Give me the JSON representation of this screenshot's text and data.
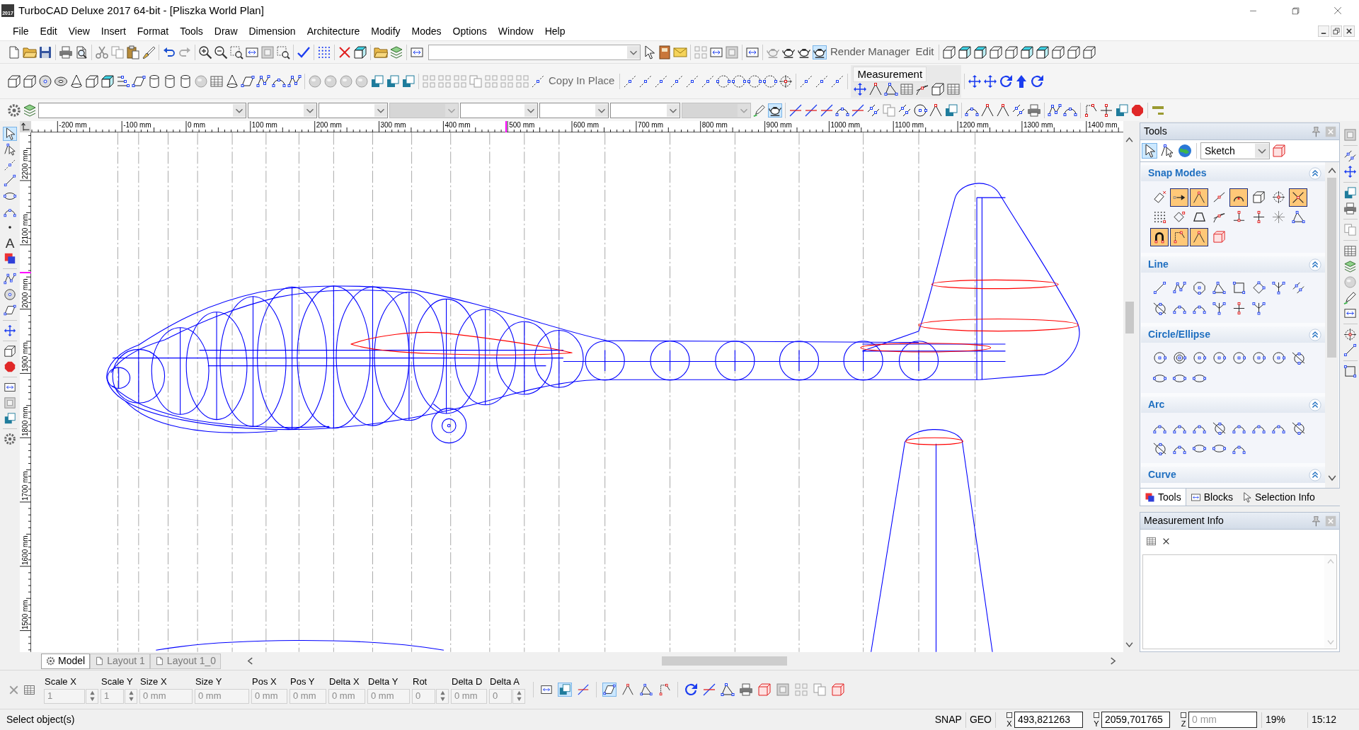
{
  "window": {
    "title": "TurboCAD Deluxe 2017 64-bit - [Pliszka World Plan]",
    "app_icon_text": "2017"
  },
  "menu": [
    "File",
    "Edit",
    "View",
    "Insert",
    "Format",
    "Tools",
    "Draw",
    "Dimension",
    "Architecture",
    "Modify",
    "Modes",
    "Options",
    "Window",
    "Help"
  ],
  "toolbars": {
    "render_modes": [
      {
        "pressed": false
      },
      {
        "pressed": false
      },
      {
        "pressed": false
      },
      {
        "pressed": true
      }
    ],
    "render_manager": "Render Manager",
    "render_edit": "Edit",
    "copy_in_place": "Copy In Place",
    "measurement": "Measurement",
    "property_combos": [
      {
        "disabled": false
      },
      {
        "disabled": false
      },
      {
        "disabled": false
      },
      {
        "disabled": true
      },
      {
        "disabled": false
      },
      {
        "disabled": false
      },
      {
        "disabled": false
      },
      {
        "disabled": true
      }
    ],
    "view_toggles": [
      {
        "pressed": false
      },
      {
        "pressed": true
      }
    ]
  },
  "rulers": {
    "horizontal": [
      "-200 mm",
      "-100 mm",
      "0 mm",
      "100 mm",
      "200 mm",
      "300 mm",
      "400 mm",
      "500 mm",
      "600 mm",
      "700 mm",
      "800 mm",
      "900 mm",
      "1000 mm",
      "1100 mm",
      "1200 mm",
      "1300 mm",
      "1400 mm"
    ],
    "vertical": [
      "2200 mm",
      "2100 mm",
      "2000 mm",
      "1900 mm",
      "1800 mm",
      "1700 mm",
      "1600 mm",
      "1500 mm"
    ]
  },
  "left_toolbar": [
    {
      "kind": "icon",
      "selected": true
    },
    {
      "kind": "icon",
      "selected": false
    },
    {
      "kind": "icon",
      "selected": false
    },
    {
      "kind": "icon",
      "selected": false
    },
    {
      "kind": "icon",
      "selected": false
    },
    {
      "kind": "icon",
      "selected": false
    },
    {
      "kind": "icon",
      "selected": false
    },
    {
      "kind": "glyph",
      "glyph": "A",
      "selected": false
    },
    {
      "kind": "icon",
      "selected": false
    },
    {
      "kind": "icon",
      "selected": false
    },
    {
      "kind": "icon",
      "selected": false
    },
    {
      "kind": "icon",
      "selected": false
    },
    {
      "kind": "icon",
      "selected": false
    },
    {
      "kind": "icon",
      "selected": false
    },
    {
      "kind": "icon",
      "selected": false
    },
    {
      "kind": "icon",
      "selected": false
    },
    {
      "kind": "icon",
      "selected": false
    },
    {
      "kind": "icon",
      "selected": false
    },
    {
      "kind": "icon",
      "selected": false
    }
  ],
  "tools_panel": {
    "title": "Tools",
    "mode_buttons": [
      {
        "selected": true
      },
      {
        "selected": false
      },
      {
        "selected": false
      }
    ],
    "workspace": "Sketch",
    "sections": [
      {
        "title": "Snap Modes",
        "kind": "toggles",
        "expanded": true,
        "buttons": [
          {
            "on": false
          },
          {
            "on": true
          },
          {
            "on": true
          },
          {
            "on": false
          },
          {
            "on": true
          },
          {
            "on": false
          },
          {
            "on": false
          },
          {
            "on": true
          },
          {
            "on": false
          },
          {
            "on": false
          },
          {
            "on": false
          },
          {
            "on": false
          },
          {
            "on": false
          },
          {
            "on": false
          },
          {
            "on": false
          },
          {
            "on": false
          },
          {
            "on": true
          },
          {
            "on": true
          },
          {
            "on": true
          },
          {
            "on": false
          }
        ]
      },
      {
        "title": "Line",
        "kind": "tools",
        "expanded": true
      },
      {
        "title": "Circle/Ellipse",
        "kind": "tools",
        "expanded": true
      },
      {
        "title": "Arc",
        "kind": "tools",
        "expanded": true
      },
      {
        "title": "Curve",
        "kind": "tools",
        "expanded": true
      }
    ],
    "tabs": [
      {
        "label": "Tools",
        "selected": true
      },
      {
        "label": "Blocks",
        "selected": false
      },
      {
        "label": "Selection Info",
        "selected": false
      }
    ]
  },
  "measurement_info": {
    "title": "Measurement Info"
  },
  "layout_tabs": [
    {
      "label": "Model",
      "selected": true
    },
    {
      "label": "Layout 1",
      "selected": false
    },
    {
      "label": "Layout 1_0",
      "selected": false
    }
  ],
  "inspector": {
    "fields": [
      {
        "label": "Scale X",
        "value": "1",
        "kind": "spin",
        "disabled": true
      },
      {
        "label": "Scale Y",
        "value": "1",
        "kind": "spin",
        "disabled": true
      },
      {
        "label": "Size X",
        "value": "0 mm",
        "kind": "text",
        "disabled": true
      },
      {
        "label": "Size Y",
        "value": "0 mm",
        "kind": "text",
        "disabled": true
      },
      {
        "label": "Pos X",
        "value": "0 mm",
        "kind": "text",
        "disabled": true
      },
      {
        "label": "Pos Y",
        "value": "0 mm",
        "kind": "text",
        "disabled": true
      },
      {
        "label": "Delta X",
        "value": "0 mm",
        "kind": "text",
        "disabled": true
      },
      {
        "label": "Delta Y",
        "value": "0 mm",
        "kind": "text",
        "disabled": true
      },
      {
        "label": "Rot",
        "value": "0",
        "kind": "spin",
        "disabled": true
      },
      {
        "label": "Delta D",
        "value": "0 mm",
        "kind": "text",
        "disabled": true
      },
      {
        "label": "Delta A",
        "value": "0",
        "kind": "spin",
        "disabled": true
      }
    ],
    "transform_tools": [
      {
        "pressed": false
      },
      {
        "pressed": true
      },
      {
        "pressed": false
      }
    ],
    "select_modes": [
      {
        "pressed": true
      },
      {
        "pressed": false
      },
      {
        "pressed": false
      },
      {
        "pressed": false
      }
    ]
  },
  "status_bar": {
    "message": "Select object(s)",
    "indicators": [
      "SNAP",
      "GEO"
    ],
    "coordinates": [
      {
        "axis": "X",
        "value": "493,821263",
        "checked": false,
        "disabled": false
      },
      {
        "axis": "Y",
        "value": "2059,701765",
        "checked": false,
        "disabled": false
      },
      {
        "axis": "Z",
        "value": "0 mm",
        "checked": false,
        "disabled": true
      }
    ],
    "zoom": "19%",
    "time": "15:12"
  }
}
